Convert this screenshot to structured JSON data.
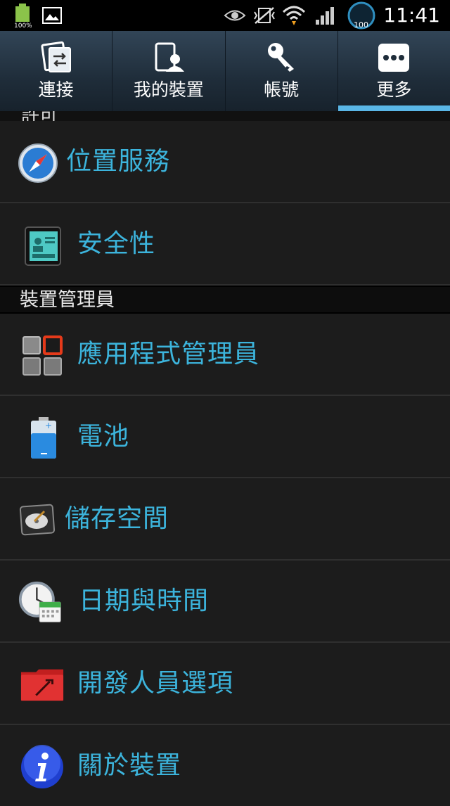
{
  "status_bar": {
    "battery_label": "100%",
    "speed_label": "100",
    "time": "11:41"
  },
  "tabs": [
    {
      "label": "連接",
      "icon": "connections-icon",
      "active": false
    },
    {
      "label": "我的裝置",
      "icon": "my-device-icon",
      "active": false
    },
    {
      "label": "帳號",
      "icon": "accounts-key-icon",
      "active": false
    },
    {
      "label": "更多",
      "icon": "more-dots-icon",
      "active": true
    }
  ],
  "cut_header": "許可",
  "items_top": [
    {
      "label": "位置服務",
      "icon": "compass-icon"
    },
    {
      "label": "安全性",
      "icon": "security-id-card-icon"
    }
  ],
  "section_device_manager": "裝置管理員",
  "items_bottom": [
    {
      "label": "應用程式管理員",
      "icon": "app-manager-icon"
    },
    {
      "label": "電池",
      "icon": "battery-icon"
    },
    {
      "label": "儲存空間",
      "icon": "hard-drive-icon"
    },
    {
      "label": "日期與時間",
      "icon": "clock-calendar-icon"
    },
    {
      "label": "開發人員選項",
      "icon": "developer-folder-icon"
    },
    {
      "label": "關於裝置",
      "icon": "info-icon"
    }
  ],
  "colors": {
    "accent": "#3cb4dc",
    "tab_indicator": "#5ab6e6",
    "background": "#1c1c1c"
  }
}
